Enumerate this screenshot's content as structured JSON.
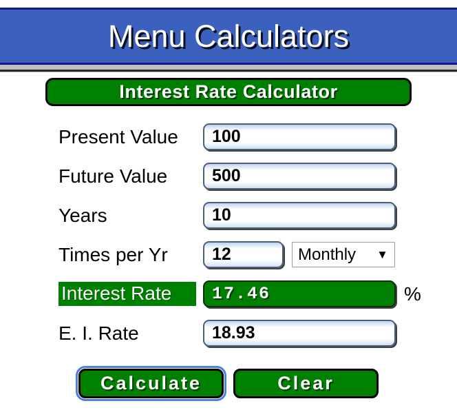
{
  "header": {
    "title": "Menu Calculators",
    "bg_color": "#3b60bd",
    "border_color": "#131b8c",
    "text_color": "#ffffff"
  },
  "calculator": {
    "title_button_label": "Interest Rate Calculator",
    "accent_green": "#008000",
    "fields": [
      {
        "label": "Present Value",
        "value": "100"
      },
      {
        "label": "Future Value",
        "value": "500"
      },
      {
        "label": "Years",
        "value": "10"
      }
    ],
    "times_per_yr": {
      "label": "Times per Yr",
      "value": "12",
      "period_selected": "Monthly",
      "dropdown_icon": "chevron-down-icon"
    },
    "interest_rate": {
      "label": "Interest Rate",
      "value": "17.46",
      "unit": "%"
    },
    "effective_rate": {
      "label": "E. I. Rate",
      "value": "18.93"
    }
  },
  "actions": {
    "calculate_label": "Calculate",
    "clear_label": "Clear",
    "focused": "calculate"
  }
}
